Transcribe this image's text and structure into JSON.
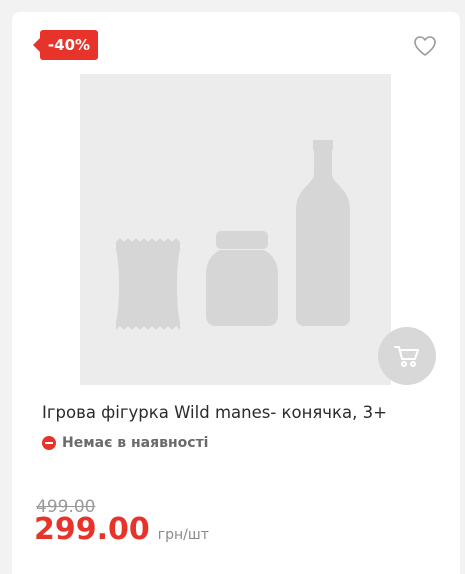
{
  "product": {
    "discount_badge": "-40%",
    "title": "Ігрова фігурка Wild manes- конячка, 3+",
    "stock_status": "Немає в наявності",
    "old_price": "499.00",
    "current_price": "299.00",
    "price_unit": "грн/шт"
  },
  "icons": {
    "favorite": "heart-outline-icon",
    "cart": "shopping-cart-icon",
    "stock": "minus-circle-icon",
    "placeholder": "product-placeholder-image"
  },
  "colors": {
    "accent": "#e8332a",
    "placeholder_bg": "#ececec",
    "placeholder_shapes": "#d6d6d6",
    "cart_button_bg": "#d8d8d8"
  }
}
